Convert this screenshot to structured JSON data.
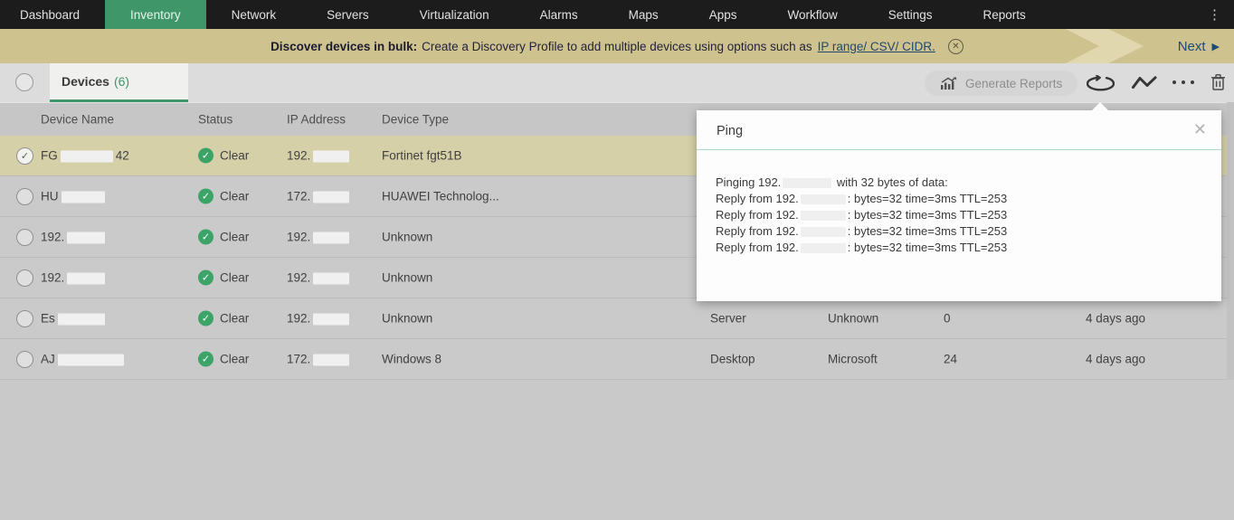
{
  "nav": {
    "items": [
      {
        "label": "Dashboard",
        "active": false
      },
      {
        "label": "Inventory",
        "active": true
      },
      {
        "label": "Network",
        "active": false
      },
      {
        "label": "Servers",
        "active": false
      },
      {
        "label": "Virtualization",
        "active": false
      },
      {
        "label": "Alarms",
        "active": false
      },
      {
        "label": "Maps",
        "active": false
      },
      {
        "label": "Apps",
        "active": false
      },
      {
        "label": "Workflow",
        "active": false
      },
      {
        "label": "Settings",
        "active": false
      },
      {
        "label": "Reports",
        "active": false
      }
    ]
  },
  "banner": {
    "bold": "Discover devices in bulk:",
    "message": "Create a Discovery Profile to add multiple devices using options such as",
    "link": "IP range/ CSV/ CIDR.",
    "next": "Next"
  },
  "tabbar": {
    "tab_label": "Devices",
    "tab_count": "(6)"
  },
  "toolbar": {
    "generate_reports": "Generate Reports"
  },
  "table": {
    "headers": {
      "name": "Device Name",
      "status": "Status",
      "ip": "IP Address",
      "type": "Device Type"
    },
    "rows": [
      {
        "name_pre": "FG",
        "name_post": "42",
        "status": "Clear",
        "ip_pre": "192.",
        "type": "Fortinet fgt51B",
        "selected": true
      },
      {
        "name_pre": "HU",
        "name_post": "",
        "status": "Clear",
        "ip_pre": "172.",
        "type": "HUAWEI Technolog...",
        "selected": false
      },
      {
        "name_pre": "192.",
        "name_post": "",
        "status": "Clear",
        "ip_pre": "192.",
        "type": "Unknown",
        "selected": false
      },
      {
        "name_pre": "192.",
        "name_post": "",
        "status": "Clear",
        "ip_pre": "192.",
        "type": "Unknown",
        "selected": false
      },
      {
        "name_pre": "Es",
        "name_post": "",
        "status": "Clear",
        "ip_pre": "192.",
        "type": "Unknown",
        "category": "Server",
        "vendor": "Unknown",
        "count": "0",
        "last_seen": "4 days ago",
        "selected": false
      },
      {
        "name_pre": "AJ",
        "name_post": "",
        "status": "Clear",
        "ip_pre": "172.",
        "type": "Windows 8",
        "category": "Desktop",
        "vendor": "Microsoft",
        "count": "24",
        "last_seen": "4 days ago",
        "selected": false
      }
    ]
  },
  "ping_popup": {
    "title": "Ping",
    "line1_pre": "Pinging 192.",
    "line1_post": "with 32 bytes of data:",
    "reply_pre": "Reply from 192.",
    "reply_post": ": bytes=32 time=3ms TTL=253"
  },
  "icons": {
    "kebab": "⋮",
    "banner_close": "✕",
    "next_arrow": "▶",
    "check": "✓",
    "popup_close": "✕"
  },
  "colors": {
    "nav_bg": "#1c1c1c",
    "accent_green": "#3f9669",
    "banner_bg": "#cec28f",
    "selected_row_bg": "#d6d0a9",
    "status_clear_green": "#3da468",
    "link_blue": "#25486f",
    "next_blue": "#1c4a77"
  }
}
